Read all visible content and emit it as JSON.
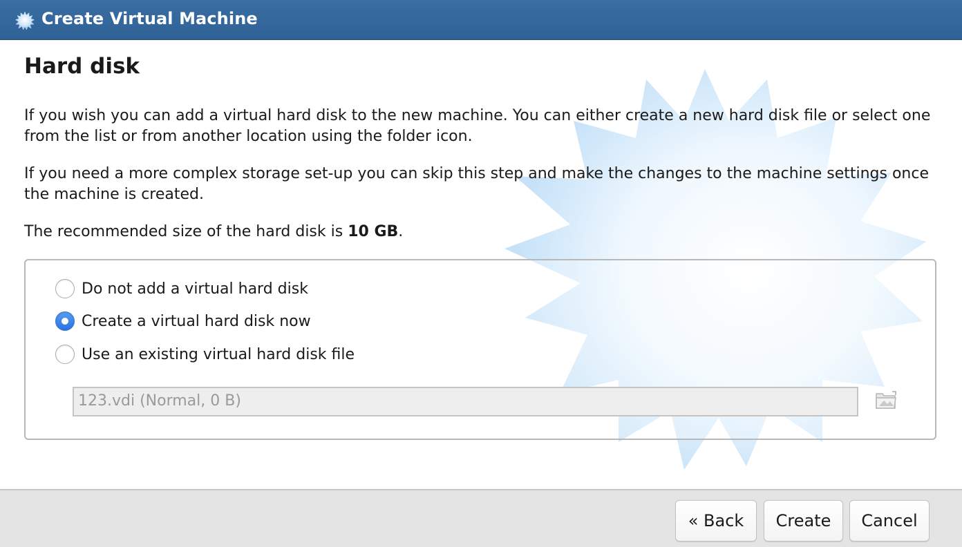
{
  "window": {
    "title": "Create Virtual Machine",
    "icon": "virtualbox-starburst-icon"
  },
  "page": {
    "heading": "Hard disk",
    "paragraph1": "If you wish you can add a virtual hard disk to the new machine. You can either create a new hard disk file or select one from the list or from another location using the folder icon.",
    "paragraph2": "If you need a more complex storage set-up you can skip this step and make the changes to the machine settings once the machine is created.",
    "recommended_prefix": "The recommended size of the hard disk is ",
    "recommended_size": "10 GB",
    "recommended_suffix": "."
  },
  "options": {
    "selected": "create",
    "items": [
      {
        "id": "none",
        "label": "Do not add a virtual hard disk",
        "checked": false
      },
      {
        "id": "create",
        "label": "Create a virtual hard disk now",
        "checked": true
      },
      {
        "id": "existing",
        "label": "Use an existing virtual hard disk file",
        "checked": false
      }
    ],
    "disk_selector": {
      "value": "123.vdi (Normal, 0 B)",
      "enabled": false,
      "folder_icon": "folder-icon"
    }
  },
  "buttons": {
    "back": "« Back",
    "create": "Create",
    "cancel": "Cancel"
  },
  "colors": {
    "titlebar": "#2f6195",
    "radio_checked": "#2b72e0",
    "watermark": "#cfe7fb"
  }
}
